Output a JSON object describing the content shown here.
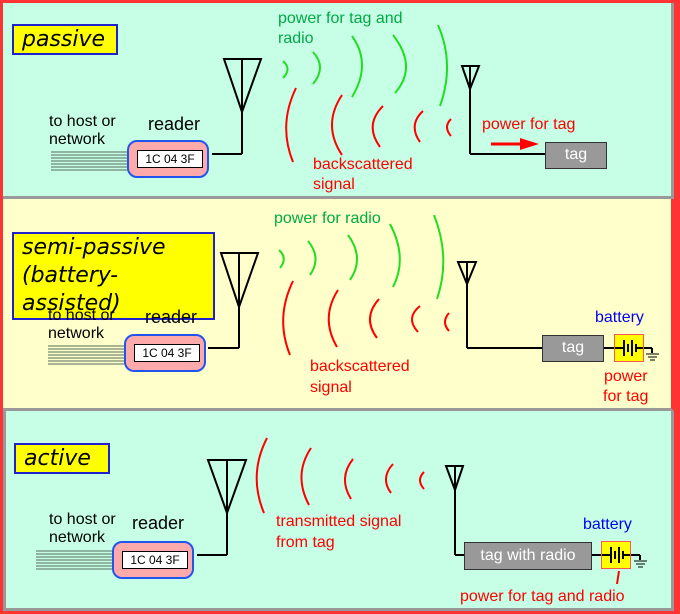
{
  "colors": {
    "outer_border": "#ff3333",
    "panel_mint": "#c6ffe6",
    "panel_cream": "#ffffcc",
    "label_box_fill": "#ffff00",
    "label_box_border": "#2222cc",
    "reader_fill": "#ffaaaa",
    "reader_border": "#2255ee",
    "tag_fill": "#999999",
    "power_wave": "#22dd22",
    "signal_wave": "#ff0000",
    "power_text": "#00aa44",
    "signal_text": "#ff0000",
    "battery_text": "#0000ee"
  },
  "common": {
    "host_label_line1": "to host or",
    "host_label_line2": "network",
    "reader_label": "reader",
    "reader_display": "1C 04 3F"
  },
  "passive": {
    "title": "passive",
    "power_label_line1": "power for tag and",
    "power_label_line2": "radio",
    "signal_label_line1": "backscattered",
    "signal_label_line2": "signal",
    "tag_power_label": "power for tag",
    "tag_label": "tag"
  },
  "semi_passive": {
    "title_line1": "semi-passive",
    "title_line2": "(battery-assisted)",
    "power_label": "power for radio",
    "signal_label_line1": "backscattered",
    "signal_label_line2": "signal",
    "tag_label": "tag",
    "battery_label": "battery",
    "battery_power_line1": "power",
    "battery_power_line2": "for tag"
  },
  "active": {
    "title": "active",
    "signal_label_line1": "transmitted signal",
    "signal_label_line2": "from tag",
    "tag_label": "tag with radio",
    "battery_label": "battery",
    "battery_power_label": "power for tag and radio"
  }
}
